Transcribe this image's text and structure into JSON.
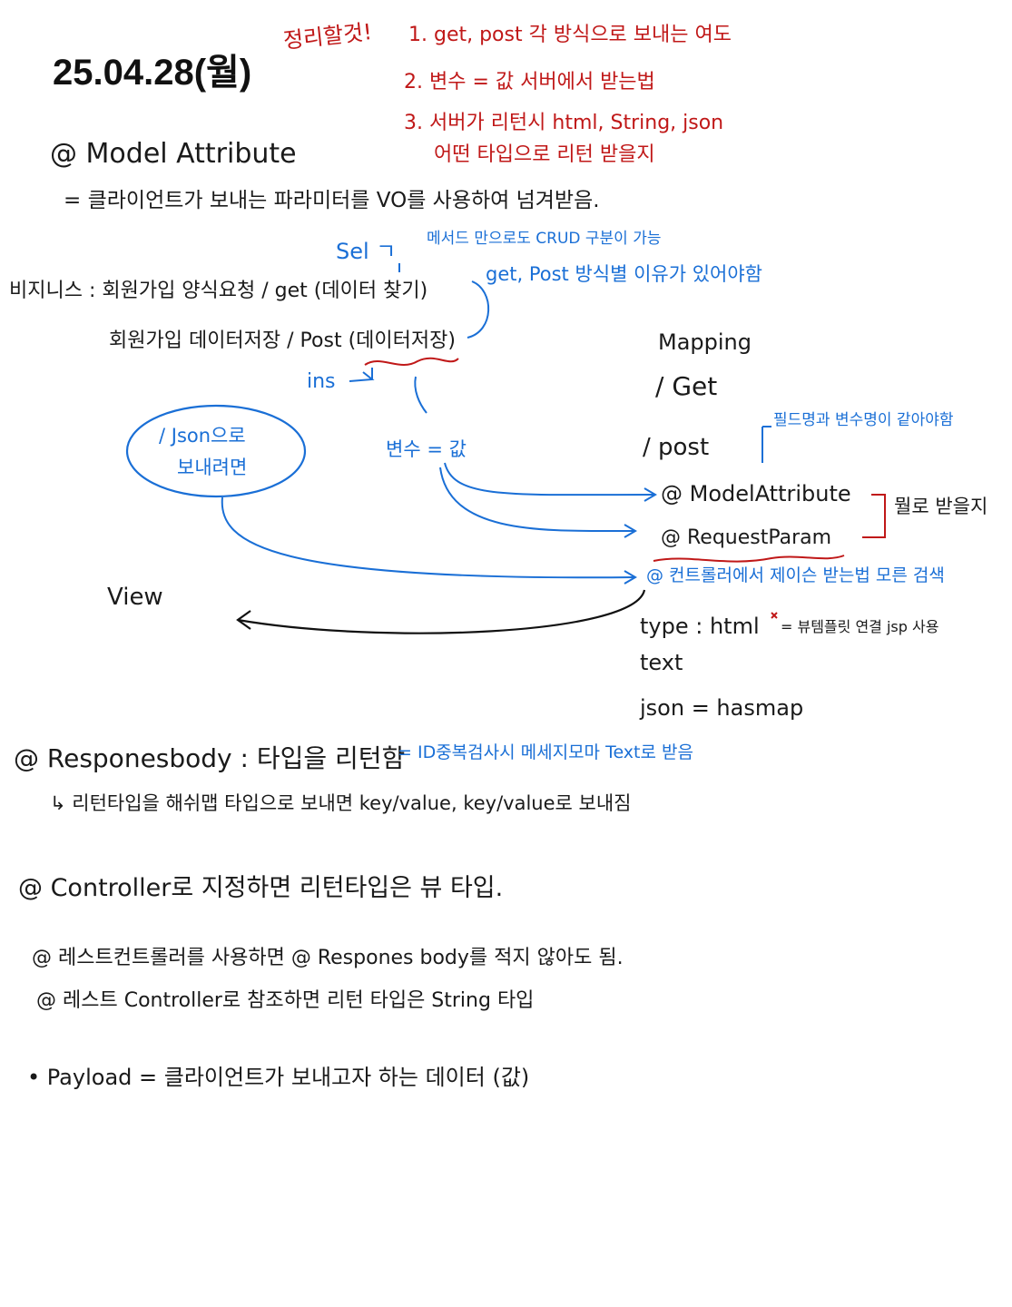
{
  "page": {
    "date_title": "25.04.28(월)"
  },
  "todo": {
    "label": "정리할것!",
    "item1": "1. get, post 각 방식으로 보내는 여도",
    "item2": "2. 변수 = 값 서버에서 받는법",
    "item3a": "3. 서버가 리턴시 html, String, json",
    "item3b": "어떤 타입으로 리턴 받을지",
    "color": "#c01818"
  },
  "model_attribute": {
    "heading": "@ Model Attribute",
    "desc": "= 클라이언트가 보내는 파라미터를 VO를 사용하여 넘겨받음."
  },
  "business": {
    "sel_label": "Sel ㄱ",
    "crud_note": "메서드 만으로도 CRUD 구분이 가능",
    "getpost_note": "get, Post 방식별 이유가 있어야함",
    "line1": "비지니스 : 회원가입 양식요청 / get (데이터 찾기)",
    "line2": "회원가입 데이터저장 / Post (데이터저장)",
    "ins_label": "ins",
    "json_bubble_line1": "/ Json으로",
    "json_bubble_line2": "보내려면",
    "var_value": "변수 = 값",
    "view_label": "View",
    "blue_color": "#1a6fd6"
  },
  "mapping": {
    "heading": "Mapping",
    "get": "/ Get",
    "post": "/ post",
    "field_note": "필드명과 변수명이 같아야함",
    "model_attr": "@ ModelAttribute",
    "request_param": "@ RequestParam",
    "receive_note": "뭘로 받을지",
    "controller_note": "@ 컨트롤러에서 제이슨 받는법 모른 검색",
    "type_html": "type : html",
    "view_note": "= 뷰템플릿 연결 jsp 사용",
    "type_text": "text",
    "json_hashmap": "json = hasmap"
  },
  "responsebody": {
    "heading": "@ Responesbody : 타입을 리턴함",
    "blue_note": "= ID중복검사시 메세지모마 Text로 받음",
    "line2": "↳ 리턴타입을 해쉬맵 타입으로 보내면 key/value, key/value로 보내짐"
  },
  "controller": {
    "line": "@ Controller로 지정하면 리턴타입은 뷰 타입."
  },
  "rest": {
    "line1": "@ 레스트컨트롤러를 사용하면 @ Respones body를 적지 않아도 됨.",
    "line2": "@ 레스트 Controller로 참조하면 리턴 타입은 String 타입"
  },
  "payload": {
    "line": "• Payload = 클라이언트가 보내고자 하는 데이터 (값)"
  }
}
